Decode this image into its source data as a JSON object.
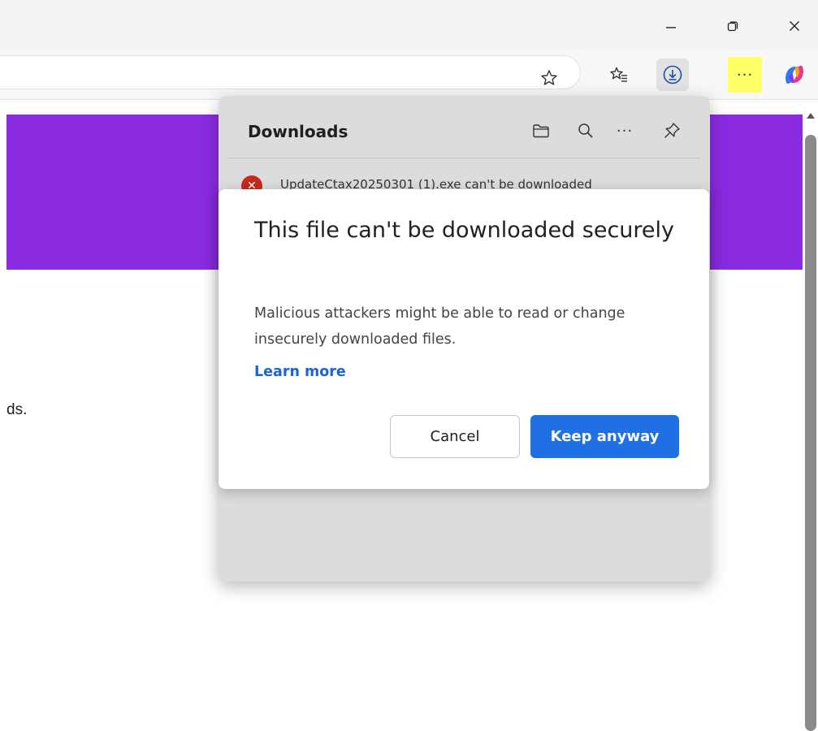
{
  "window": {
    "minimize_icon": "minimize-icon",
    "restore_icon": "restore-icon",
    "close_icon": "close-icon"
  },
  "toolbar": {
    "favorite_icon": "star-outline-icon",
    "favorites_icon": "favorites-list-icon",
    "downloads_icon": "download-circle-icon",
    "more_label": "···",
    "copilot_icon": "copilot-icon"
  },
  "page": {
    "hero_color": "#8a2be2",
    "visible_text": "ds."
  },
  "downloads_panel": {
    "title": "Downloads",
    "more_label": "···",
    "item": {
      "name": "UpdateCtax20250301 (1).exe can't be downloaded",
      "status_icon": "error-icon"
    }
  },
  "dialog": {
    "title": "This file can't be downloaded securely",
    "body": "Malicious attackers might be able to read or change insecurely downloaded files.",
    "learn_more": "Learn more",
    "cancel_label": "Cancel",
    "keep_label": "Keep anyway",
    "accent_color": "#1f6fe5"
  }
}
